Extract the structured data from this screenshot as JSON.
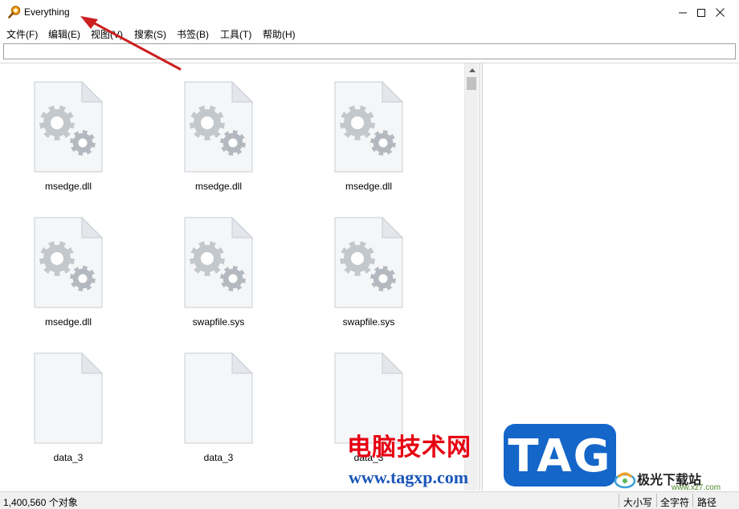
{
  "window": {
    "title": "Everything"
  },
  "menu": [
    {
      "label": "文件(F)"
    },
    {
      "label": "编辑(E)"
    },
    {
      "label": "视图(V)"
    },
    {
      "label": "搜索(S)"
    },
    {
      "label": "书签(B)"
    },
    {
      "label": "工具(T)"
    },
    {
      "label": "帮助(H)"
    }
  ],
  "search": {
    "value": "",
    "placeholder": ""
  },
  "results": [
    {
      "name": "msedge.dll",
      "icon": "dll-gear-file-icon"
    },
    {
      "name": "msedge.dll",
      "icon": "dll-gear-file-icon"
    },
    {
      "name": "msedge.dll",
      "icon": "dll-gear-file-icon"
    },
    {
      "name": "msedge.dll",
      "icon": "dll-gear-file-icon"
    },
    {
      "name": "swapfile.sys",
      "icon": "sys-gear-file-icon"
    },
    {
      "name": "swapfile.sys",
      "icon": "sys-gear-file-icon"
    },
    {
      "name": "data_3",
      "icon": "blank-file-icon"
    },
    {
      "name": "data_3",
      "icon": "blank-file-icon"
    },
    {
      "name": "data_3",
      "icon": "blank-file-icon"
    }
  ],
  "status": {
    "count": "1,400,560 个对象",
    "match_case": "大小写",
    "whole_word": "全字符",
    "path": "路径"
  },
  "watermark": {
    "site_cn": "电脑技术网",
    "site_url": "www.tagxp.com",
    "tag": "TAG",
    "jg_cn": "极光下载站",
    "jg_url": "www.xz7.com"
  },
  "colors": {
    "accent_arrow": "#cc1f1f",
    "watermark_red": "#e60012",
    "watermark_blue": "#1466c8"
  }
}
